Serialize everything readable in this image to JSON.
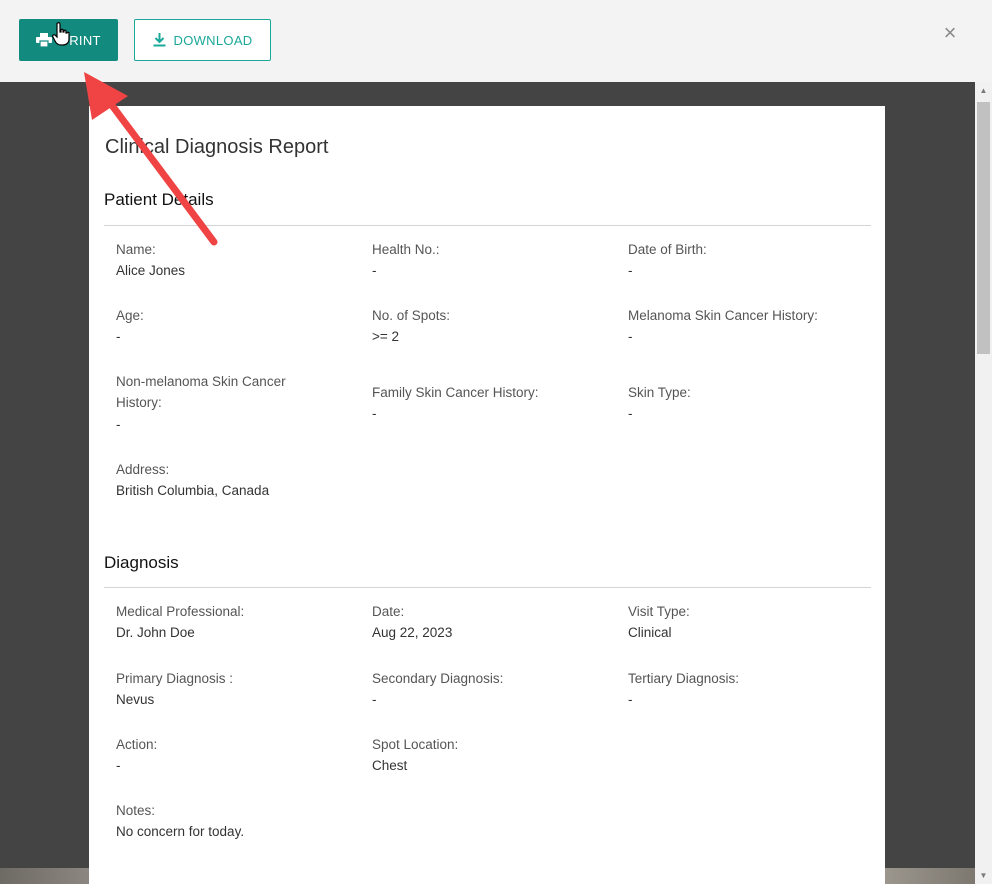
{
  "toolbar": {
    "print_label": "PRINT",
    "download_label": "DOWNLOAD",
    "close_glyph": "×"
  },
  "report": {
    "title": "Clinical Diagnosis Report",
    "patient_section": "Patient Details",
    "diagnosis_section": "Diagnosis",
    "patient_fields": [
      {
        "label": "Name:",
        "value": "Alice Jones"
      },
      {
        "label": "Health No.:",
        "value": "-"
      },
      {
        "label": "Date of Birth:",
        "value": "-"
      },
      {
        "label": "Age:",
        "value": "-"
      },
      {
        "label": "No. of Spots:",
        "value": ">= 2"
      },
      {
        "label": "Melanoma Skin Cancer History:",
        "value": "-"
      },
      {
        "label": "Non-melanoma Skin Cancer History:",
        "value": "-"
      },
      {
        "label": "Family Skin Cancer History:",
        "value": "-"
      },
      {
        "label": "Skin Type:",
        "value": "-"
      },
      {
        "label": "Address:",
        "value": "British Columbia, Canada"
      }
    ],
    "diagnosis_fields": [
      {
        "label": "Medical Professional:",
        "value": "Dr. John Doe"
      },
      {
        "label": "Date:",
        "value": "Aug 22, 2023"
      },
      {
        "label": "Visit Type:",
        "value": "Clinical"
      },
      {
        "label": "Primary Diagnosis :",
        "value": "Nevus"
      },
      {
        "label": "Secondary Diagnosis:",
        "value": "-"
      },
      {
        "label": "Tertiary Diagnosis:",
        "value": "-"
      },
      {
        "label": "Action:",
        "value": "-"
      },
      {
        "label": "Spot Location:",
        "value": "Chest"
      },
      {
        "label": "Notes:",
        "value": "No concern for today."
      }
    ]
  },
  "colors": {
    "primary": "#138a7e",
    "accent": "#1aa89a",
    "annotation_arrow": "#f04444"
  },
  "icons": [
    "printer-icon",
    "download-icon",
    "close-icon",
    "hand-cursor-icon"
  ]
}
